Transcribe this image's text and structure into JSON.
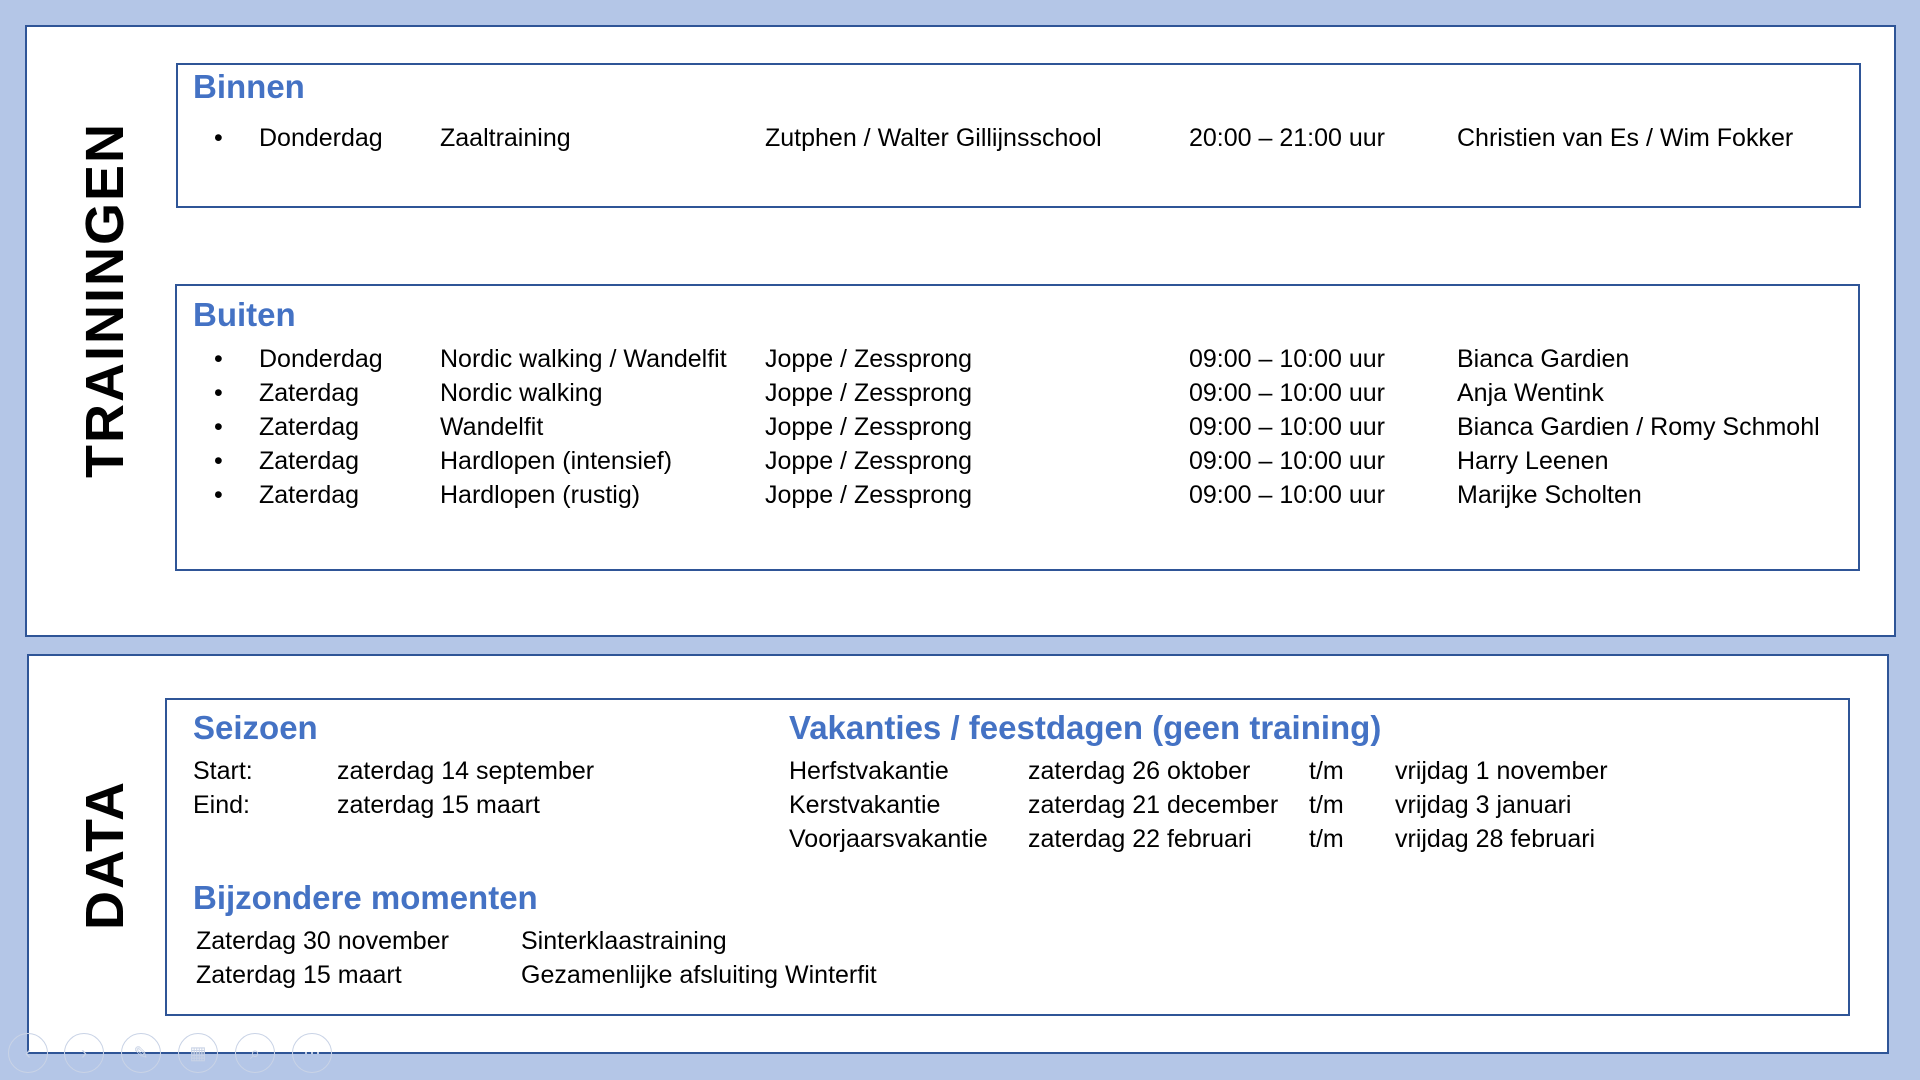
{
  "sections": {
    "trainingen_label": "TRAININGEN",
    "data_label": "DATA"
  },
  "binnen": {
    "title": "Binnen",
    "rows": [
      {
        "bullet": "•",
        "day": "Donderdag",
        "activity": "Zaaltraining",
        "location": "Zutphen / Walter Gillijnsschool",
        "time": "20:00 – 21:00 uur",
        "trainer": "Christien van Es / Wim Fokker"
      }
    ]
  },
  "buiten": {
    "title": "Buiten",
    "rows": [
      {
        "bullet": "•",
        "day": "Donderdag",
        "activity": "Nordic walking / Wandelfit",
        "location": "Joppe / Zessprong",
        "time": "09:00 – 10:00 uur",
        "trainer": "Bianca Gardien"
      },
      {
        "bullet": "•",
        "day": "Zaterdag",
        "activity": "Nordic walking",
        "location": "Joppe / Zessprong",
        "time": "09:00 – 10:00 uur",
        "trainer": "Anja Wentink"
      },
      {
        "bullet": "•",
        "day": "Zaterdag",
        "activity": "Wandelfit",
        "location": "Joppe / Zessprong",
        "time": "09:00 – 10:00 uur",
        "trainer": "Bianca Gardien / Romy Schmohl"
      },
      {
        "bullet": "•",
        "day": "Zaterdag",
        "activity": "Hardlopen (intensief)",
        "location": "Joppe / Zessprong",
        "time": "09:00 – 10:00 uur",
        "trainer": "Harry Leenen"
      },
      {
        "bullet": "•",
        "day": "Zaterdag",
        "activity": "Hardlopen (rustig)",
        "location": "Joppe / Zessprong",
        "time": "09:00 – 10:00 uur",
        "trainer": "Marijke Scholten"
      }
    ]
  },
  "seizoen": {
    "title": "Seizoen",
    "rows": [
      {
        "label": "Start:",
        "value": "zaterdag 14 september"
      },
      {
        "label": "Eind:",
        "value": "zaterdag 15 maart"
      }
    ]
  },
  "vakanties": {
    "title": "Vakanties / feestdagen (geen training)",
    "rows": [
      {
        "name": "Herfstvakantie",
        "from": "zaterdag 26 oktober",
        "sep": "t/m",
        "to": "vrijdag 1 november"
      },
      {
        "name": "Kerstvakantie",
        "from": "zaterdag 21 december",
        "sep": "t/m",
        "to": "vrijdag 3 januari"
      },
      {
        "name": "Voorjaarsvakantie",
        "from": "zaterdag 22 februari",
        "sep": "t/m",
        "to": "vrijdag 28 februari"
      }
    ]
  },
  "bijzondere": {
    "title": "Bijzondere momenten",
    "rows": [
      {
        "date": "Zaterdag 30 november",
        "event": "Sinterklaastraining"
      },
      {
        "date": "Zaterdag 15 maart",
        "event": "Gezamenlijke afsluiting Winterfit"
      }
    ]
  },
  "toolbar": {
    "icons": [
      "previous-icon",
      "next-icon",
      "pen-icon",
      "slides-icon",
      "zoom-icon",
      "more-icon"
    ],
    "glyphs": [
      "‹",
      "›",
      "✎",
      "▦",
      "⌕",
      "⋯"
    ]
  },
  "colors": {
    "background": "#b4c6e7",
    "border": "#2f5597",
    "heading": "#4472c4"
  }
}
